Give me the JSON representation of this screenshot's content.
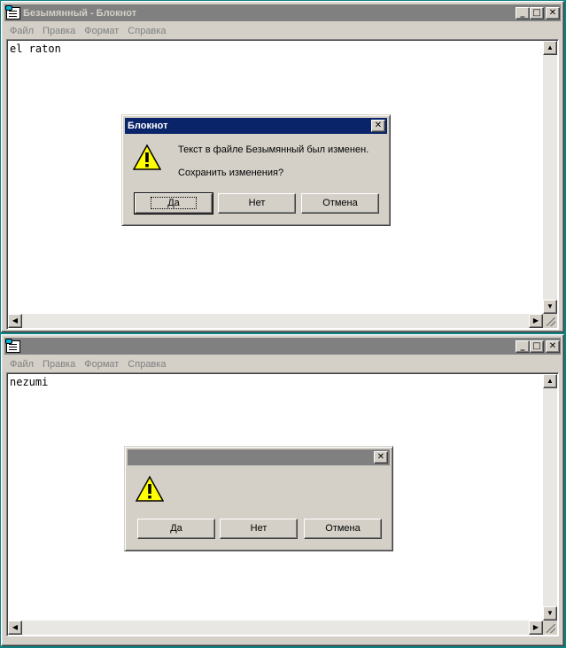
{
  "top_window": {
    "title": "Безымянный - Блокнот",
    "menu": [
      "Файл",
      "Правка",
      "Формат",
      "Справка"
    ],
    "text": "el raton",
    "dialog": {
      "title": "Блокнот",
      "message_line1": "Текст в файле Безымянный был изменен.",
      "message_line2": "Сохранить изменения?",
      "buttons": [
        "Да",
        "Нет",
        "Отмена"
      ]
    }
  },
  "bottom_window": {
    "title": "",
    "menu": [
      "Файл",
      "Правка",
      "Формат",
      "Справка"
    ],
    "text": "nezumi",
    "dialog": {
      "title": "",
      "buttons": [
        "Да",
        "Нет",
        "Отмена"
      ]
    }
  },
  "icons": {
    "app": "notepad-icon",
    "warning": "warning-icon",
    "minimize": "minimize-icon",
    "maximize": "maximize-icon",
    "close": "close-icon"
  },
  "colors": {
    "desktop": "#0e8181",
    "title_active": "#0a246a",
    "title_inactive": "#808080",
    "face": "#d4d0c8"
  }
}
